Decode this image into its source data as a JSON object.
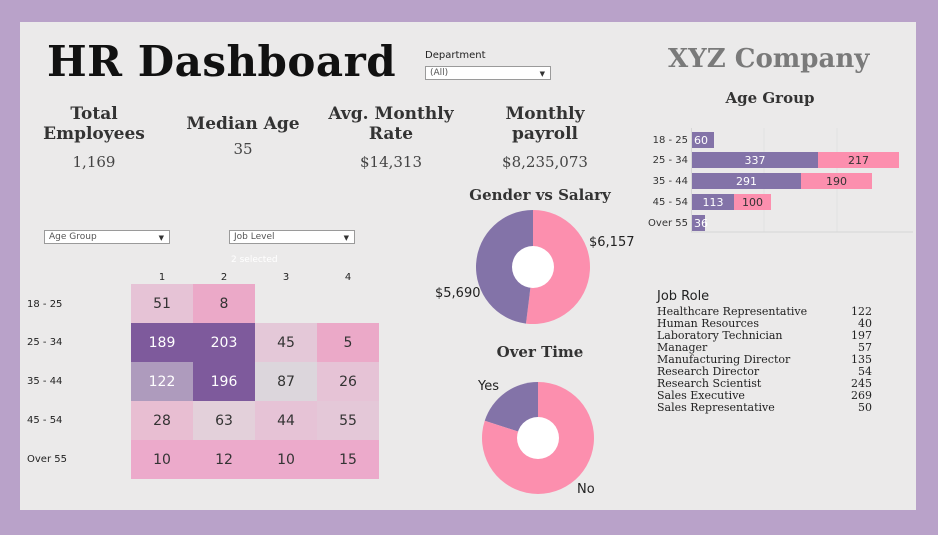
{
  "header": {
    "title": "HR Dashboard",
    "company": "XYZ Company"
  },
  "department_filter": {
    "label": "Department",
    "value": "(All)"
  },
  "kpis": [
    {
      "title_line1": "Total",
      "title_line2": "Employees",
      "value": "1,169"
    },
    {
      "title_line1": "Median Age",
      "title_line2": "",
      "value": "35"
    },
    {
      "title_line1": "Avg. Monthly",
      "title_line2": "Rate",
      "value": "$14,313"
    },
    {
      "title_line1": "Monthly",
      "title_line2": "payroll",
      "value": "$8,235,073"
    }
  ],
  "filters": {
    "age_group": {
      "value": "Age Group"
    },
    "job_level": {
      "value": "Job Level",
      "note": "2 selected"
    }
  },
  "heatmap": {
    "columns": [
      "1",
      "2",
      "3",
      "4"
    ],
    "rows": [
      "18 - 25",
      "25 - 34",
      "35 - 44",
      "45 - 54",
      "Over 55"
    ],
    "values": [
      [
        51,
        8,
        null,
        null
      ],
      [
        189,
        203,
        45,
        5
      ],
      [
        122,
        196,
        87,
        26
      ],
      [
        28,
        63,
        44,
        55
      ],
      [
        10,
        12,
        10,
        15
      ]
    ],
    "colors": [
      [
        "#e6c3d6",
        "#eba9c8",
        null,
        null
      ],
      [
        "#7e5a9c",
        "#7e5a9c",
        "#e4c8d8",
        "#eba9c8"
      ],
      [
        "#ae9bbd",
        "#7e5a9c",
        "#dcd6dc",
        "#e6c3d6"
      ],
      [
        "#e8bed2",
        "#e3d0da",
        "#e6c3d6",
        "#e4c8d8"
      ],
      [
        "#ecaacb",
        "#ecaacb",
        "#ecaacb",
        "#ecaacb"
      ]
    ]
  },
  "gender_salary": {
    "title": "Gender vs Salary",
    "labels": [
      "$6,157",
      "$5,690"
    ],
    "colors": [
      "#fc8fae",
      "#8373a8"
    ]
  },
  "over_time": {
    "title": "Over Time",
    "labels": [
      "Yes",
      "No"
    ],
    "colors": [
      "#8373a8",
      "#fc8fae"
    ]
  },
  "age_group_chart": {
    "title": "Age Group",
    "categories": [
      "18 - 25",
      "25 - 34",
      "35 - 44",
      "45 - 54",
      "Over 55"
    ],
    "series": [
      {
        "values": [
          60,
          337,
          291,
          113,
          36
        ],
        "color": "#8373a8"
      },
      {
        "values": [
          null,
          217,
          190,
          100,
          null
        ],
        "color": "#fc8fae"
      }
    ]
  },
  "job_role": {
    "title": "Job Role",
    "rows": [
      {
        "role": "Healthcare Representative",
        "count": "122"
      },
      {
        "role": "Human Resources",
        "count": "40"
      },
      {
        "role": "Laboratory Technician",
        "count": "197"
      },
      {
        "role": "Manager",
        "count": "57"
      },
      {
        "role": "Manufacturing Director",
        "count": "135"
      },
      {
        "role": "Research Director",
        "count": "54"
      },
      {
        "role": "Research Scientist",
        "count": "245"
      },
      {
        "role": "Sales Executive",
        "count": "269"
      },
      {
        "role": "Sales Representative",
        "count": "50"
      }
    ]
  },
  "chart_data": [
    {
      "type": "heatmap",
      "title": "",
      "x": [
        "1",
        "2",
        "3",
        "4"
      ],
      "y": [
        "18 - 25",
        "25 - 34",
        "35 - 44",
        "45 - 54",
        "Over 55"
      ],
      "values": [
        [
          51,
          8,
          null,
          null
        ],
        [
          189,
          203,
          45,
          5
        ],
        [
          122,
          196,
          87,
          26
        ],
        [
          28,
          63,
          44,
          55
        ],
        [
          10,
          12,
          10,
          15
        ]
      ]
    },
    {
      "type": "pie",
      "title": "Gender vs Salary",
      "labels": [
        "$6,157",
        "$5,690"
      ],
      "values": [
        6157,
        5690
      ]
    },
    {
      "type": "pie",
      "title": "Over Time",
      "labels": [
        "Yes",
        "No"
      ],
      "values": [
        20,
        80
      ]
    },
    {
      "type": "bar",
      "title": "Age Group",
      "categories": [
        "18 - 25",
        "25 - 34",
        "35 - 44",
        "45 - 54",
        "Over 55"
      ],
      "series": [
        {
          "values": [
            60,
            337,
            291,
            113,
            36
          ]
        },
        {
          "values": [
            null,
            217,
            190,
            100,
            null
          ]
        }
      ]
    }
  ]
}
